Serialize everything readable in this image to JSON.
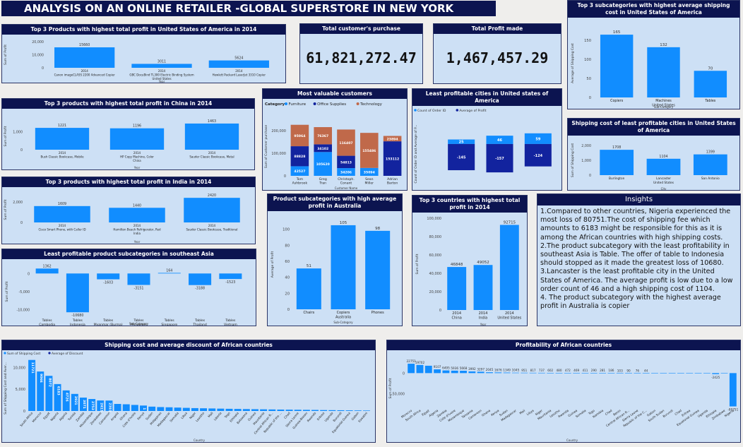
{
  "dashboard_title": "ANALYSIS ON AN ONLINE RETAILER -GLOBAL SUPERSTORE IN NEW YORK",
  "kpis": {
    "customer_purchase_title": "Total customer's purchase",
    "customer_purchase_value": "61,821,272.47",
    "profit_title": "Total Profit made",
    "profit_value": "1,467,457.29"
  },
  "insights": {
    "title": "Insights",
    "points": [
      "1.Compared to other countries, Nigeria experienced the most loss of 80751.The cost of shipping fee which amounts to 6183 might be responsible for this as it is among the African countries with high shipping costs.",
      "2.The product subcategory with the least profitability in southeast Asia  is Table. The offer of table to Indonesia should stopped as it made the greatest loss of 10680.",
      "3.Lancaster is the least profitable city in the United States of America. The average profit is low due to a low order count of 46 and a high  shipping cost of 1104.",
      "4. The product subcategory with the highest average profit in Australia is  copier"
    ]
  },
  "colors": {
    "bar": "#118dff",
    "navy": "#12239e",
    "orange": "#c0694a",
    "header": "#0c1450",
    "card": "#cde0f5"
  },
  "chart_data": [
    {
      "id": "usa_products",
      "type": "bar",
      "title": "Top 3 Products with highest total profit in United States of America in 2014",
      "categories": [
        "Canon imageCLASS 2200 Advanced Copier",
        "GBC DocuBind TL300 Electric Binding System",
        "Hewlett Packard LaserJet 3310 Copier"
      ],
      "cat_year": [
        "2014",
        "2014",
        "2014"
      ],
      "cat_country": [
        "",
        "United States",
        ""
      ],
      "values": [
        15660,
        3011,
        5624
      ],
      "value_labels": [
        "15660",
        "3011",
        "5624"
      ],
      "yticks": [
        0,
        10000,
        20000
      ],
      "ytick_labels": [
        "0",
        "10,000",
        "20,000"
      ],
      "ylim": [
        0,
        20000
      ],
      "xlabel": "Year",
      "ylabel": "Sum of Profit"
    },
    {
      "id": "china_products",
      "type": "bar",
      "title": "Top 3 products with highest total profit in China in 2014",
      "categories": [
        "Bush Classic Bookcase, Mobile",
        "HP Copy Machine, Color",
        "Sauder Classic Bookcase, Metal"
      ],
      "cat_year": [
        "2014",
        "2014",
        "2014"
      ],
      "cat_country": [
        "",
        "China",
        ""
      ],
      "values": [
        1221,
        1196,
        1463
      ],
      "value_labels": [
        "1221",
        "1196",
        "1463"
      ],
      "yticks": [
        0,
        1000
      ],
      "ytick_labels": [
        "0",
        "1,000"
      ],
      "ylim": [
        0,
        1500
      ],
      "xlabel": "Year",
      "ylabel": "Sum of Profit"
    },
    {
      "id": "india_products",
      "type": "bar",
      "title": "Top 3 products with highest total profit in India in 2014",
      "categories": [
        "Cisco Smart Phone, with Caller ID",
        "Hamilton Beach Refrigerator, Red",
        "Sauder Classic Bookcase, Traditional"
      ],
      "cat_year": [
        "2014",
        "2014",
        "2014"
      ],
      "cat_country": [
        "",
        "India",
        ""
      ],
      "values": [
        1609,
        1440,
        2420
      ],
      "value_labels": [
        "1609",
        "1440",
        "2420"
      ],
      "yticks": [
        0,
        2000
      ],
      "ytick_labels": [
        "0",
        "2,000"
      ],
      "ylim": [
        0,
        2500
      ],
      "xlabel": "Year",
      "ylabel": "Sum of Profit"
    },
    {
      "id": "sea_subcategories",
      "type": "bar",
      "title": "Least profitable product subcategories in southeast Asia",
      "categories": [
        "Tables",
        "Tables",
        "Tables",
        "Tables",
        "Tables",
        "Tables",
        "Tables"
      ],
      "cat_country": [
        "Cambodia",
        "Indonesia",
        "Myanmar (Burma)",
        "Philippines",
        "Singapore",
        "Thailand",
        "Vietnam"
      ],
      "values": [
        1362,
        -10680,
        -1603,
        -3151,
        164,
        -3188,
        -1523
      ],
      "value_labels": [
        "1362",
        "-10680",
        "-1603",
        "-3151",
        "164",
        "-3188",
        "-1523"
      ],
      "yticks": [
        0,
        -5000,
        -10000
      ],
      "ytick_labels": [
        "0",
        "-5,000",
        "-10,000"
      ],
      "ylim": [
        -12000,
        2000
      ],
      "xlabel": "Sub-Category",
      "ylabel": "Sum of Profit"
    },
    {
      "id": "valuable_customers",
      "type": "bar",
      "stacked": true,
      "title": "Most valuable customers",
      "legend_title": "Category",
      "categories": [
        "Tom Ashbrook",
        "Greg Tran",
        "Christoph. Conant",
        "Sean Miller",
        "Adrian Barton"
      ],
      "series": [
        {
          "name": "Furniture",
          "color": "#118dff",
          "values": [
            42527,
            105620,
            34206,
            35094,
            0
          ],
          "value_labels": [
            "42527",
            "105620",
            "34206",
            "35094",
            ""
          ]
        },
        {
          "name": "Office Supplies",
          "color": "#12239e",
          "values": [
            88828,
            34102,
            54813,
            0,
            153112
          ],
          "value_labels": [
            "88828",
            "34102",
            "54813",
            "",
            "153112"
          ]
        },
        {
          "name": "Technology",
          "color": "#c0694a",
          "values": [
            95064,
            76367,
            116407,
            155486,
            23894
          ],
          "value_labels": [
            "95064",
            "76367",
            "116407",
            "155486",
            "23894"
          ]
        }
      ],
      "yticks": [
        0,
        100000,
        200000
      ],
      "ytick_labels": [
        "0",
        "100,000",
        "200,000"
      ],
      "ylim": [
        0,
        260000
      ],
      "xlabel": "Customer Name",
      "ylabel": "Sum of Customer purchase"
    },
    {
      "id": "usa_cities",
      "type": "bar",
      "title": "Least profitable cities in United states of America",
      "legend": [
        "Count of Order ID",
        "Average of Profit"
      ],
      "categories": [
        "Burlington",
        "Lancaster",
        "San Antonio"
      ],
      "cat_country": [
        "",
        "United States",
        ""
      ],
      "series": [
        {
          "name": "Count of Order ID",
          "color": "#118dff",
          "values": [
            25,
            46,
            59
          ]
        },
        {
          "name": "Average of Profit",
          "color": "#12239e",
          "values": [
            -145,
            -157,
            -124
          ]
        }
      ],
      "xlabel": "City",
      "ylabel": "Count of Order ID and Average of P..."
    },
    {
      "id": "usa_shipping_subcat",
      "type": "bar",
      "title": "Top 3 subcategories with highest average shipping cost in United States of America",
      "categories": [
        "Copiers",
        "Machines",
        "Tables"
      ],
      "cat_country": [
        "",
        "United States",
        ""
      ],
      "values": [
        165,
        132,
        70
      ],
      "value_labels": [
        "165",
        "132",
        "70"
      ],
      "yticks": [
        0,
        50,
        100,
        150
      ],
      "ytick_labels": [
        "0",
        "50",
        "100",
        "150"
      ],
      "ylim": [
        0,
        180
      ],
      "xlabel": "Sub-Category",
      "ylabel": "Average of Shipping Cost"
    },
    {
      "id": "usa_city_shipping",
      "type": "bar",
      "title": "Shipping cost of least profitable cities in United States of America",
      "categories": [
        "Burlington",
        "Lancaster",
        "San Antonio"
      ],
      "cat_country": [
        "",
        "United States",
        ""
      ],
      "values": [
        1708,
        1104,
        1399
      ],
      "value_labels": [
        "1708",
        "1104",
        "1399"
      ],
      "yticks": [
        0,
        1000,
        2000
      ],
      "ytick_labels": [
        "0",
        "1,000",
        "2,000"
      ],
      "ylim": [
        0,
        2000
      ],
      "xlabel": "City",
      "ylabel": "Sum of Shipping Cost"
    },
    {
      "id": "australia_subcat",
      "type": "bar",
      "title": "Product subcategories with high average profit in Australia",
      "categories": [
        "Chairs",
        "Copiers",
        "Phones"
      ],
      "cat_country": [
        "",
        "Australia",
        ""
      ],
      "values": [
        51,
        105,
        98
      ],
      "value_labels": [
        "51",
        "105",
        "98"
      ],
      "yticks": [
        0,
        20,
        40,
        60,
        80,
        100
      ],
      "ytick_labels": [
        "0",
        "20",
        "40",
        "60",
        "80",
        "100"
      ],
      "ylim": [
        0,
        112
      ],
      "xlabel": "Sub-Category",
      "ylabel": "Average of Profit"
    },
    {
      "id": "top_countries",
      "type": "bar",
      "title": "Top 3 countries with highest total profit in 2014",
      "categories": [
        "China",
        "India",
        "United States"
      ],
      "cat_year": [
        "2014",
        "2014",
        "2014"
      ],
      "values": [
        46848,
        49052,
        92715
      ],
      "value_labels": [
        "46848",
        "49052",
        "92715"
      ],
      "yticks": [
        0,
        20000,
        40000,
        60000,
        80000,
        100000
      ],
      "ytick_labels": [
        "0",
        "20,000",
        "40,000",
        "60,000",
        "80,000",
        "100,000"
      ],
      "ylim": [
        0,
        100000
      ],
      "xlabel": "Year",
      "ylabel": "Sum of Profit"
    },
    {
      "id": "africa_shipping",
      "type": "bar",
      "title": "Shipping cost and average discount of African countries",
      "legend": [
        "Sum of Shipping Cost",
        "Average of Discount"
      ],
      "categories": [
        "South Africa",
        "Morocco",
        "Egypt",
        "Nigeria",
        "Algeria",
        "Tunisia",
        "Zambia",
        "Mozambique",
        "Zimbabwe",
        "Cameroon",
        "Angola",
        "Ghana",
        "Cote d'Ivoire",
        "Kenya",
        "Sudan",
        "Philippines",
        "Madagascar",
        "Somalia",
        "Libya",
        "Niger",
        "Lesotho",
        "Mali",
        "Liberia",
        "Togo",
        "Ethiopia",
        "Botswana",
        "Guinea",
        "Mauritania",
        "Central African R...",
        "Republic of the ...",
        "Chad",
        "Sierra Leone",
        "Guinea-Bissau",
        "Rwanda",
        "Eritrea",
        "Uganda",
        "Burundi",
        "Equatorial Guinea",
        "Gabon",
        "Eswatini"
      ],
      "values": [
        11721,
        9066,
        8072,
        6183,
        4726,
        3921,
        3071,
        2753,
        2413,
        2393,
        1620,
        1540,
        1390,
        1250,
        1000,
        900,
        850,
        780,
        720,
        660,
        620,
        580,
        540,
        500,
        470,
        440,
        410,
        380,
        350,
        320,
        300,
        280,
        260,
        240,
        210,
        190,
        170,
        150,
        130,
        110
      ],
      "value_labels": [
        "11721",
        "9066",
        "8072",
        "6183",
        "4726",
        "3921",
        "3071",
        "2753",
        "2413",
        "2393",
        "",
        "",
        "",
        "1",
        "",
        "",
        "",
        "",
        "",
        "",
        "",
        "",
        "",
        "",
        "",
        "",
        "",
        "",
        "",
        "",
        "",
        "",
        "",
        "",
        "",
        "",
        "",
        "",
        "",
        ""
      ],
      "yticks": [
        0,
        5000,
        10000
      ],
      "ytick_labels": [
        "0",
        "5,000",
        "10,000"
      ],
      "ylim": [
        0,
        12000
      ],
      "xlabel": "Country",
      "ylabel": "Sum of Shipping Cost and Aver..."
    },
    {
      "id": "africa_profit",
      "type": "bar",
      "title": "Profitability of African countries",
      "categories": [
        "Morocco",
        "South Africa",
        "Egypt",
        "Algeria",
        "Zambia",
        "Cote d'Ivoire",
        "Mozambique",
        "Tanzania",
        "Cameroon",
        "Ghana",
        "Kenya",
        "Sudan",
        "Madagascar",
        "Mali",
        "Libya",
        "Niger",
        "Mauritania",
        "Lesotho",
        "Rwanda",
        "Guinea",
        "Somalia",
        "Togo",
        "Namibia",
        "Chad",
        "Benin",
        "Central African R...",
        "Sierra Leone",
        "Republic of the C...",
        "Gabon",
        "South Sudan",
        "Burundi",
        "Chad",
        "Eritrea",
        "Equatorial Guinea",
        "Uganda",
        "Ethiopia",
        "Zimbabwe",
        "Nigeria"
      ],
      "values": [
        22751,
        19702,
        17850,
        9107,
        6495,
        5936,
        5668,
        3992,
        3297,
        2045,
        1676,
        1349,
        1045,
        951,
        817,
        737,
        602,
        480,
        472,
        469,
        411,
        290,
        281,
        186,
        103,
        90,
        76,
        44,
        20,
        10,
        5,
        0,
        -10,
        -20,
        -40,
        -2425,
        -500,
        -80751
      ],
      "value_labels": [
        "22751",
        "19702",
        "",
        "9107",
        "6495",
        "5936",
        "5668",
        "3992",
        "3297",
        "2045",
        "1676",
        "1349",
        "1045",
        "951",
        "817",
        "737",
        "602",
        "480",
        "472",
        "469",
        "411",
        "290",
        "281",
        "186",
        "103",
        "90",
        "76",
        "44",
        "",
        "",
        "",
        "",
        "",
        "",
        "",
        "-2425",
        "",
        "-80751"
      ],
      "yticks": [
        0,
        -50000
      ],
      "ytick_labels": [
        "0",
        "-50,000"
      ],
      "ylim": [
        -85000,
        28000
      ],
      "xlabel": "Country",
      "ylabel": "Sum of Profit"
    }
  ]
}
